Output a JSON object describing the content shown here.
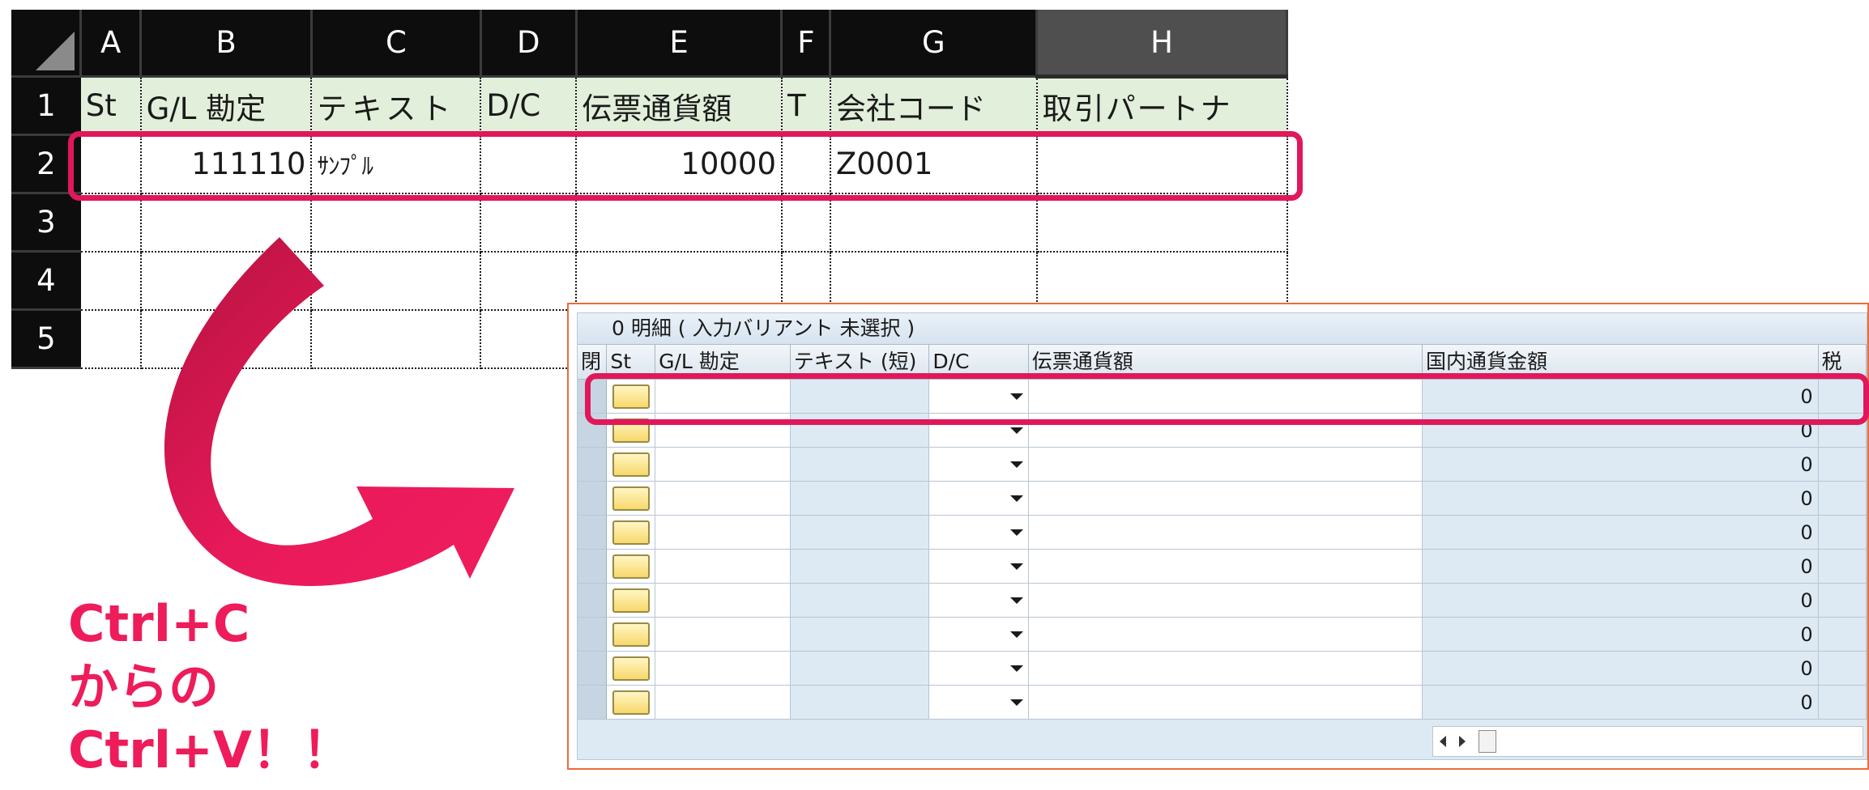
{
  "excel": {
    "column_letters": [
      "A",
      "B",
      "C",
      "D",
      "E",
      "F",
      "G",
      "H"
    ],
    "row_numbers": [
      "1",
      "2",
      "3",
      "4",
      "5"
    ],
    "header_row": [
      "St",
      "G/L 勘定",
      "テキスト",
      "D/C",
      "伝票通貨額",
      "T",
      "会社コード",
      "取引パートナ"
    ],
    "data_row": [
      "",
      "111110",
      "ｻﾝﾌﾟﾙ",
      "",
      "10000",
      "",
      "Z0001",
      ""
    ]
  },
  "caption": {
    "line1": "Ctrl+C",
    "line2": "からの",
    "line3": "Ctrl+V！！"
  },
  "sap": {
    "title": "0 明細 ( 入力バリアント 未選択 )",
    "columns": [
      "閉",
      "St",
      "G/L 勘定",
      "テキスト (短)",
      "D/C",
      "伝票通貨額",
      "国内通貨金額",
      "税"
    ],
    "row_values": [
      "0",
      "0",
      "0",
      "0",
      "0",
      "0",
      "0",
      "0",
      "0",
      "0"
    ]
  },
  "colors": {
    "highlight": "#e0185a",
    "arrow": "#e8195a",
    "excel_header_row": "#e2efda",
    "sap_background": "#dde9f3",
    "sap_frame": "#ef6a3c"
  }
}
